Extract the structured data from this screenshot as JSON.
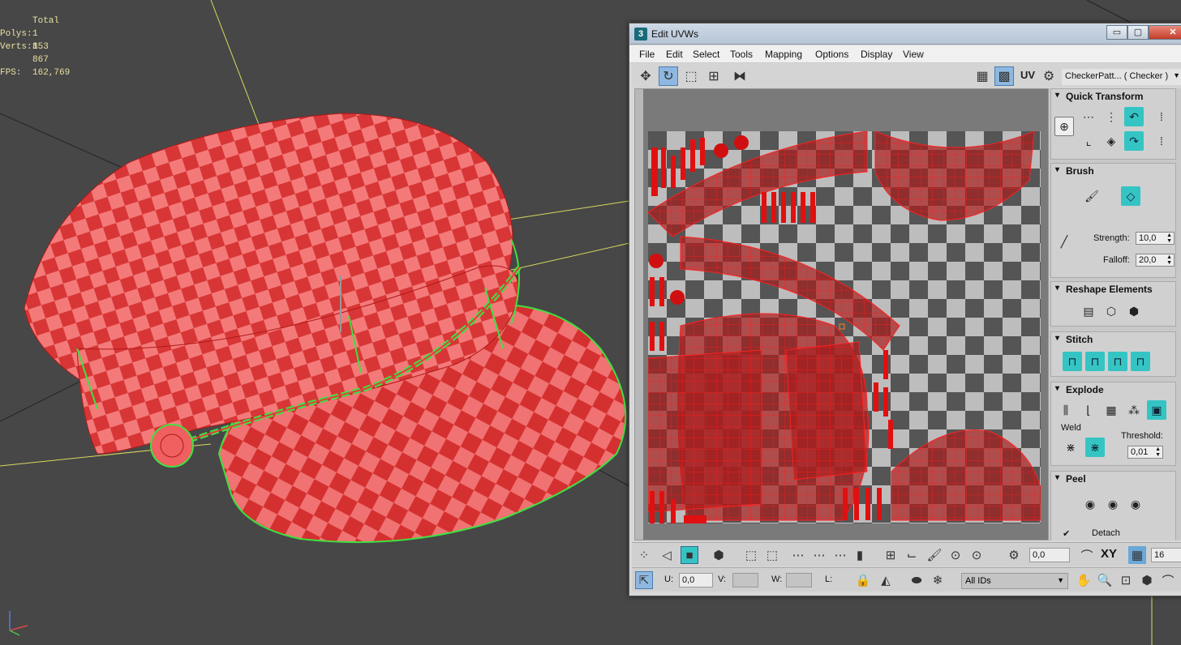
{
  "viewport": {
    "stats": {
      "header": "Total",
      "polys_label": "Polys:",
      "polys_value": "1 853",
      "verts_label": "Verts:",
      "verts_value": "1 867",
      "fps_label": "FPS:",
      "fps_value": "162,769"
    },
    "colors": {
      "mesh": "#f04848",
      "seam": "#40e040",
      "background": "#474747",
      "grid": "#d8d860"
    }
  },
  "uvw_window": {
    "app_icon": "3",
    "title": "Edit UVWs",
    "controls": {
      "min": "▭",
      "max": "▢",
      "close": "✕"
    },
    "menu": [
      "File",
      "Edit",
      "Select",
      "Tools",
      "Mapping",
      "Options",
      "Display",
      "View"
    ],
    "toolbar": {
      "uv_label": "UV",
      "texture_select": "CheckerPatt... ( Checker )"
    },
    "panel": {
      "quick_transform": {
        "title": "Quick Transform"
      },
      "brush": {
        "title": "Brush",
        "strength_label": "Strength:",
        "strength_value": "10,0",
        "falloff_label": "Falloff:",
        "falloff_value": "20,0"
      },
      "reshape": {
        "title": "Reshape Elements"
      },
      "stitch": {
        "title": "Stitch"
      },
      "explode": {
        "title": "Explode",
        "weld_label": "Weld",
        "threshold_label": "Threshold:",
        "threshold_value": "0,01"
      },
      "peel": {
        "title": "Peel",
        "detach_label": "Detach"
      }
    },
    "bottom": {
      "rotate_value": "0,0",
      "xy_label": "XY",
      "grid_value": "16",
      "u_label": "U:",
      "u_value": "0,0",
      "v_label": "V:",
      "w_label": "W:",
      "l_label": "L:",
      "ids_select": "All IDs"
    }
  }
}
